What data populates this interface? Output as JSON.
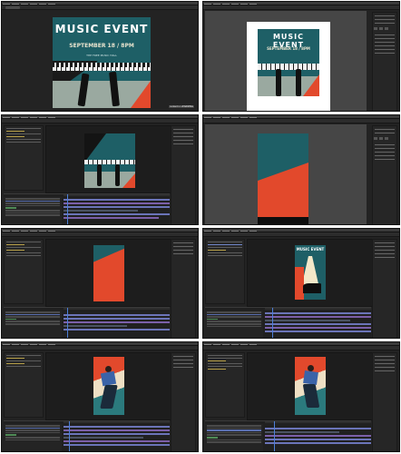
{
  "poster": {
    "title": "MUSIC EVENT",
    "date_line": "SEPTEMBER 18 / 8PM",
    "venue_line": "THE FREE MUSIC HALL"
  },
  "watermark": "Linked in LEARNING",
  "icons": [
    "menu-bar",
    "timeline",
    "viewer",
    "properties-panel"
  ],
  "colors": {
    "teal": "#1e5f66",
    "orange": "#e2492c",
    "sage": "#9aa9a0",
    "ui_bg": "#232323",
    "timeline_bar": "#6b74b8"
  }
}
